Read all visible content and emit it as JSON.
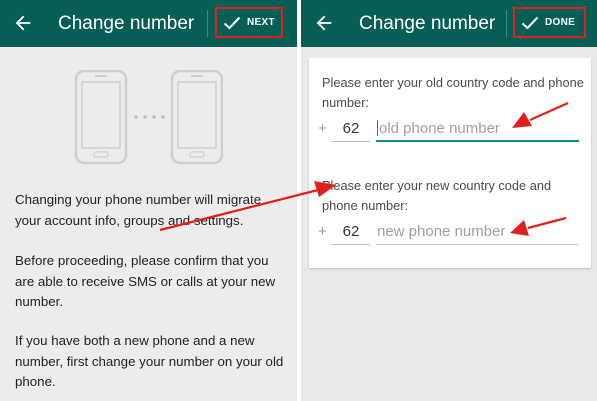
{
  "left_screen": {
    "title": "Change number",
    "action_label": "NEXT",
    "paragraphs": [
      "Changing your phone number will migrate your account info, groups and settings.",
      "Before proceeding, please confirm that you are able to receive SMS or calls at your new number.",
      "If you have both a new phone and a new number, first change your number on your old phone."
    ]
  },
  "right_screen": {
    "title": "Change number",
    "action_label": "DONE",
    "old_number": {
      "prompt": "Please enter your old country code and phone number:",
      "plus": "+",
      "country_code": "62",
      "placeholder": "old phone number"
    },
    "new_number": {
      "prompt": "Please enter your new country code and phone number:",
      "plus": "+",
      "country_code": "62",
      "placeholder": "new phone number"
    }
  },
  "colors": {
    "appbar": "#075e54",
    "accent": "#128c7e",
    "highlight": "#e0201b"
  },
  "icons": {
    "back": "arrow-left-icon",
    "confirm": "check-icon",
    "illustration": "two-phones-icon",
    "pointer": "red-arrow-icon"
  }
}
